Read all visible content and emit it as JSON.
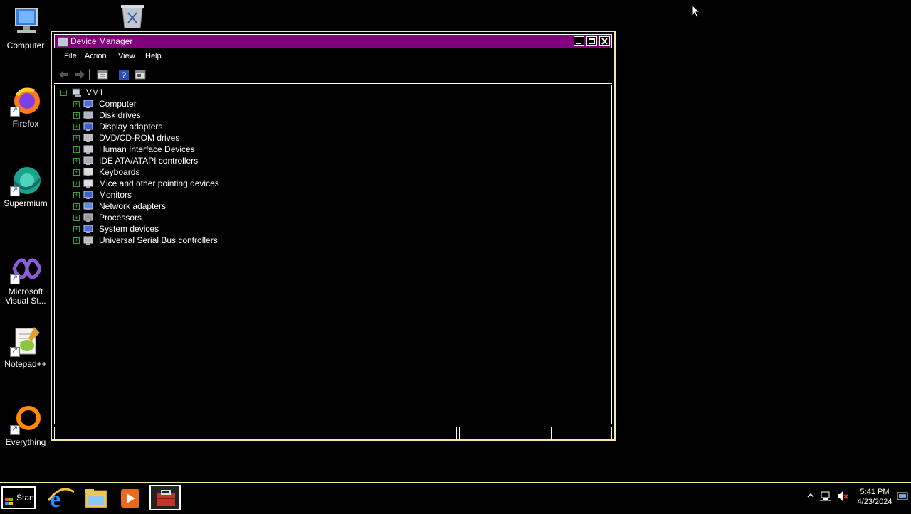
{
  "desktop": {
    "icons": [
      {
        "label": "Computer",
        "icon": "computer-icon"
      },
      {
        "label": "Recycle Bin",
        "icon": "recycle-bin-icon"
      },
      {
        "label": "Firefox",
        "icon": "firefox-icon"
      },
      {
        "label": "Supermium",
        "icon": "supermium-icon"
      },
      {
        "label": "Microsoft Visual St...",
        "icon": "visual-studio-icon"
      },
      {
        "label": "Notepad++",
        "icon": "notepadpp-icon"
      },
      {
        "label": "Everything",
        "icon": "everything-icon"
      }
    ]
  },
  "window": {
    "title": "Device Manager",
    "controls": {
      "minimize": "minimize-icon",
      "maximize": "maximize-icon",
      "close": "close-icon"
    },
    "menu": [
      "File",
      "Action",
      "View",
      "Help"
    ],
    "toolbar": [
      "back-icon",
      "forward-icon",
      "properties-icon",
      "help-icon",
      "view-icon"
    ],
    "tree": {
      "root": "VM1",
      "items": [
        {
          "label": "Computer",
          "icon": "computer-icon"
        },
        {
          "label": "Disk drives",
          "icon": "disk-drive-icon"
        },
        {
          "label": "Display adapters",
          "icon": "display-adapter-icon"
        },
        {
          "label": "DVD/CD-ROM drives",
          "icon": "dvd-drive-icon"
        },
        {
          "label": "Human Interface Devices",
          "icon": "hid-icon"
        },
        {
          "label": "IDE ATA/ATAPI controllers",
          "icon": "ide-controller-icon"
        },
        {
          "label": "Keyboards",
          "icon": "keyboard-icon"
        },
        {
          "label": "Mice and other pointing devices",
          "icon": "mouse-icon"
        },
        {
          "label": "Monitors",
          "icon": "monitor-icon"
        },
        {
          "label": "Network adapters",
          "icon": "network-adapter-icon"
        },
        {
          "label": "Processors",
          "icon": "processor-icon"
        },
        {
          "label": "System devices",
          "icon": "system-device-icon"
        },
        {
          "label": "Universal Serial Bus controllers",
          "icon": "usb-icon"
        }
      ]
    }
  },
  "taskbar": {
    "start_label": "Start",
    "apps": [
      "internet-explorer-icon",
      "file-explorer-icon",
      "media-player-icon",
      "device-manager-icon"
    ],
    "tray": [
      "show-hidden-icons-icon",
      "network-icon",
      "volume-muted-icon",
      "action-center-icon"
    ],
    "clock_time": "5:41 PM",
    "clock_date": "4/23/2024"
  },
  "colors": {
    "titlebar": "#800080",
    "window_border": "#f2e9a6",
    "expander": "#3c9b3c"
  }
}
